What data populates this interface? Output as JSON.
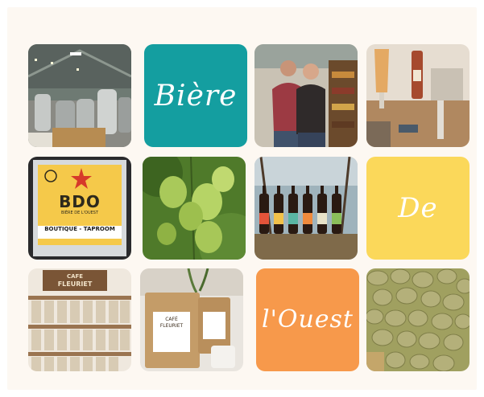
{
  "tiles": {
    "biere": {
      "text": "Bière",
      "color": "#149ea0"
    },
    "de": {
      "text": "De",
      "color": "#fbd85a"
    },
    "louest": {
      "text": "l'Ouest",
      "color": "#f7994b"
    }
  },
  "sign": {
    "logo": "BDO",
    "subtitle": "BIÈRE DE L'OUEST",
    "banner": "BOUTIQUE - TAPROOM"
  },
  "cafe_sign": {
    "line1": "CAFE",
    "line2": "FLEURIET"
  },
  "coffee_bag": {
    "line1": "CAFÉ",
    "line2": "FLEURIET"
  }
}
